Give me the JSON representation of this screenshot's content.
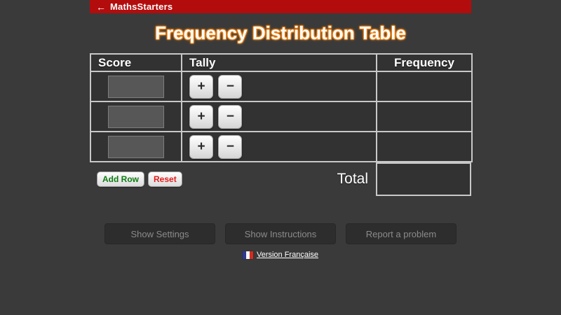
{
  "topbar": {
    "back_arrow": "←",
    "brand": "MathsStarters",
    "bg_color": "#b30c0c"
  },
  "page_title": "Frequency Distribution Table",
  "table": {
    "headers": {
      "score": "Score",
      "tally": "Tally",
      "frequency": "Frequency"
    },
    "plus_label": "+",
    "minus_label": "−",
    "rows": [
      {
        "score_value": "",
        "frequency_value": ""
      },
      {
        "score_value": "",
        "frequency_value": ""
      },
      {
        "score_value": "",
        "frequency_value": ""
      }
    ],
    "total_label": "Total",
    "total_value": ""
  },
  "actions": {
    "add_row": "Add Row",
    "reset": "Reset"
  },
  "footer_buttons": {
    "settings": "Show Settings",
    "instructions": "Show Instructions",
    "report": "Report a problem"
  },
  "language": {
    "label": "Version Française",
    "flag": "french-flag"
  },
  "colors": {
    "background": "#3a3a3a",
    "topbar_red": "#b30c0c",
    "title_glow": "#ef8418",
    "table_border": "#c8c8c8",
    "cell_bg": "#323232",
    "add_row_green": "#0e7c12",
    "reset_red": "#e31b1b",
    "footer_btn_text": "#8b8b8b"
  }
}
